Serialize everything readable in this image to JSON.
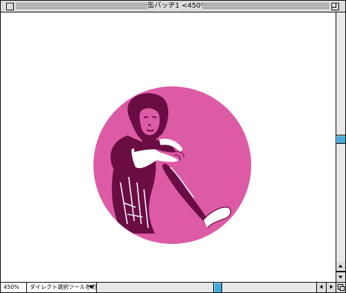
{
  "window": {
    "title": "缶バッヂ1 <450%>"
  },
  "status_bar": {
    "zoom": "450%",
    "tool_hint": "ダイレクト選択ツールを切り換え"
  },
  "artwork": {
    "background_color": "#dd5ba5",
    "figure_color": "#6b0d45",
    "highlight_color": "#ffffff"
  },
  "icons": {
    "close": "close-box-icon",
    "zoom": "zoom-box-icon",
    "scroll_up": "arrow-up-icon",
    "scroll_down": "arrow-down-icon",
    "scroll_left": "arrow-left-icon",
    "scroll_right": "arrow-right-icon",
    "menu_caret": "triangle-down-icon",
    "grow": "grow-box-icon"
  }
}
